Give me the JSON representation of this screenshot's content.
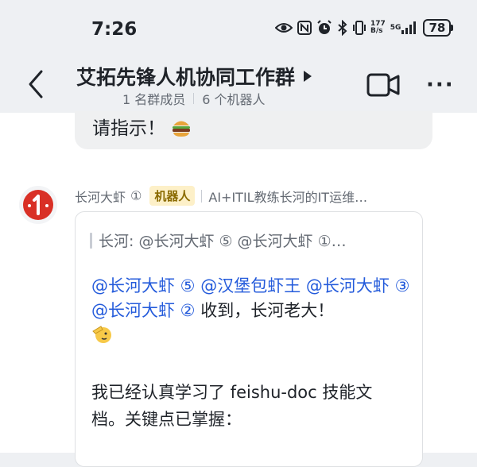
{
  "status_bar": {
    "time": "7:26",
    "net_speed_value": "177",
    "net_speed_unit": "B/s",
    "signal_label": "5G",
    "battery": "78"
  },
  "header": {
    "title": "艾拓先锋人机协同工作群",
    "member_count": "1 名群成员",
    "bot_count": "6 个机器人"
  },
  "previous_message": {
    "text": "请指示！"
  },
  "message": {
    "sender": "长河大虾",
    "sender_number": "①",
    "badge": "机器人",
    "description": "AI+ITIL教练长河的IT运维…",
    "quote": "长河: @长河大虾 ⑤ @长河大虾 ①…",
    "mentions": [
      "@长河大虾 ⑤",
      "@汉堡包虾王",
      "@长河大虾 ③",
      "@长河大虾 ②"
    ],
    "reply_text": "收到，长河老大！",
    "para2_line1": "我已经认真学习了 feishu-doc 技能文",
    "para2_line2": "档。关键点已掌握："
  },
  "colors": {
    "mention": "#245bdb",
    "bot_badge_bg": "#fdf0c8",
    "avatar_red": "#d93026"
  }
}
